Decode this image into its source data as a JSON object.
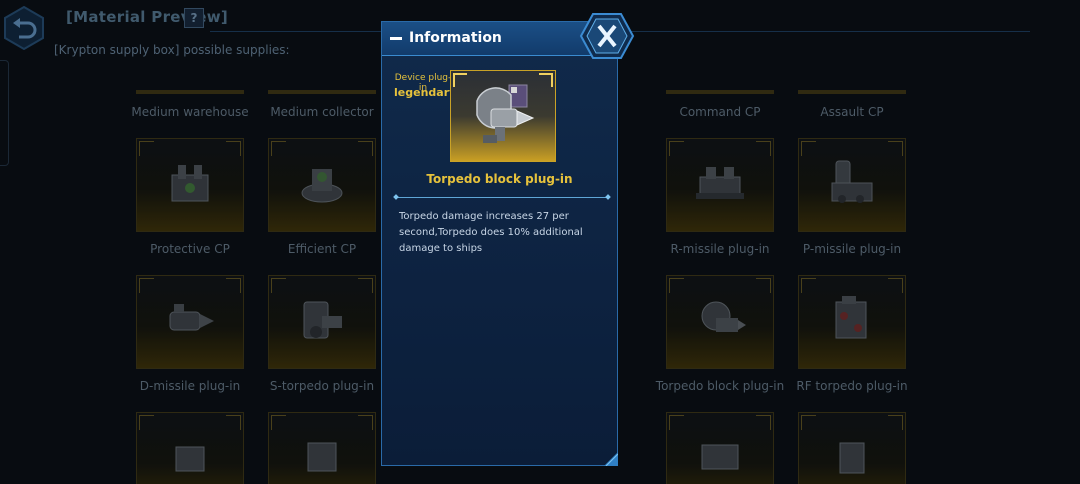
{
  "header": {
    "title": "[Material Preview]",
    "help_label": "?"
  },
  "subtitle": "[Krypton supply box] possible supplies:",
  "grid": {
    "header_row": [
      "Medium warehouse",
      "Medium collector",
      "",
      "",
      "Command CP",
      "Assault CP"
    ],
    "row1": [
      "Protective CP",
      "Efficient CP",
      "",
      "",
      "R-missile plug-in",
      "P-missile plug-in"
    ],
    "row2": [
      "D-missile plug-in",
      "S-torpedo plug-in",
      "",
      "",
      "Torpedo block plug-in",
      "RF torpedo plug-in"
    ]
  },
  "info": {
    "title": "Information",
    "item_type": "Device plug-in",
    "rarity": "legendary",
    "item_name": "Torpedo block plug-in",
    "description": "Torpedo damage increases 27 per second,Torpedo does 10% additional damage to ships"
  },
  "colors": {
    "legendary": "#e6c23c",
    "panel": "#0d2240",
    "accent": "#2a6aa8"
  },
  "icons": {
    "back": "back-arrow-icon",
    "close": "close-x-icon",
    "minimize": "minus-icon"
  }
}
